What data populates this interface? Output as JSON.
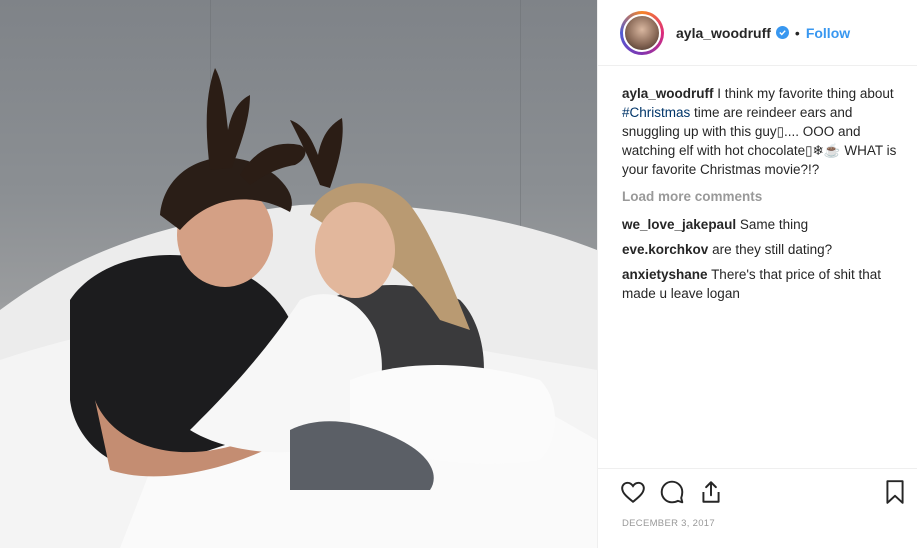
{
  "post": {
    "username": "ayla_woodruff",
    "follow_label": "Follow",
    "separator": "•",
    "caption_username": "ayla_woodruff",
    "caption_text_1": "I think my favorite thing about ",
    "caption_hashtag": "#Christmas",
    "caption_text_2": " time are reindeer ears and snuggling up with this guy▯.... OOO and watching elf with hot chocolate▯❄☕ WHAT is your favorite Christmas movie?!?",
    "load_more_label": "Load more comments",
    "comments": [
      {
        "user": "we_love_jakepaul",
        "text": "Same thing"
      },
      {
        "user": "eve.korchkov",
        "text": "are they still dating?"
      },
      {
        "user": "anxietyshane",
        "text": "There's that price of shit that made u leave logan"
      }
    ],
    "date": "DECEMBER 3, 2017",
    "icons": {
      "like": "heart-icon",
      "comment": "comment-icon",
      "share": "share-icon",
      "save": "bookmark-icon",
      "verified": "verified-badge-icon"
    },
    "colors": {
      "link_blue": "#3897f0",
      "hashtag": "#003569",
      "muted": "#999999",
      "text": "#262626"
    }
  }
}
